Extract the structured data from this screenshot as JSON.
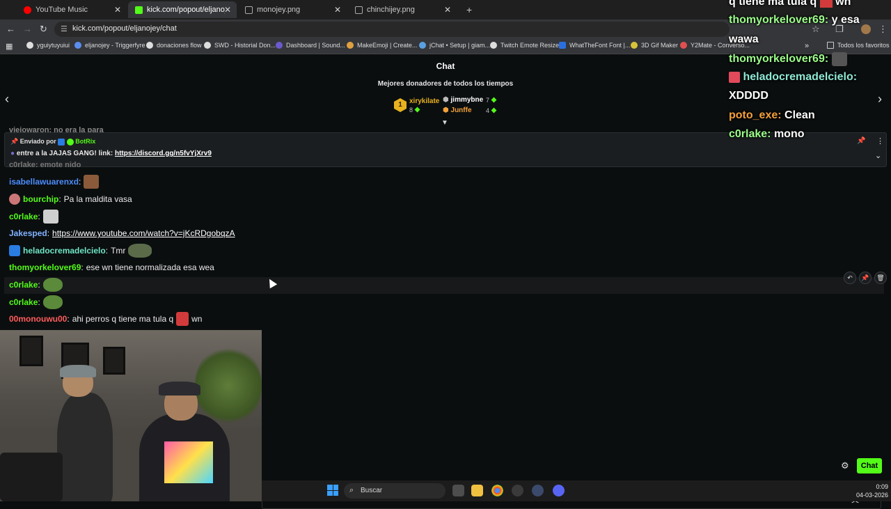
{
  "browser": {
    "tabs": [
      {
        "label": "YouTube Music",
        "active": false,
        "color": "#ff0000"
      },
      {
        "label": "kick.com/popout/eljanojey/cha",
        "active": true,
        "color": "#53fc18"
      },
      {
        "label": "monojey.png",
        "active": false,
        "color": "#888888"
      },
      {
        "label": "chinchijey.png",
        "active": false,
        "color": "#888888"
      }
    ],
    "url": "kick.com/popout/eljanojey/chat",
    "bookmarks": [
      "yguiytuyuiui",
      "eljanojey - Triggerfyre",
      "donaciones flow",
      "SWD - Historial Don...",
      "Dashboard | Sound...",
      "MakeEmoji | Create...",
      "jChat • Setup | giam...",
      "Twitch Emote Resizer",
      "WhatTheFont Font |...",
      "3D Gif Maker",
      "Y2Mate - Converso...",
      "Todos los favoritos"
    ]
  },
  "chat": {
    "title": "Chat",
    "top_donors_title": "Mejores donadores de todos los tiempos",
    "donors": [
      {
        "rank": "1",
        "name": "xirykilate",
        "count": "8",
        "color": "#e8b21f"
      },
      {
        "name": "jimmybne",
        "count": "7",
        "color": "#ffffff"
      },
      {
        "name": "Junffe",
        "count": "4",
        "color": "#f4a13a"
      }
    ],
    "peek_top": "viejowaron: no era la para",
    "peek_mid": "c0rlake: emote nido",
    "pinned": {
      "sent_by": "Enviado por",
      "bot_name": "BotRix",
      "message": "entre a la JAJAS GANG! link:",
      "link": "https://discord.gg/n5fvYjXrv9"
    },
    "messages": [
      {
        "user": "isabellawuarenxd",
        "color": "#4c8dff",
        "text": "",
        "emote": "#8a5a3a"
      },
      {
        "user": "bourchip",
        "color": "#53fc18",
        "text": "Pa la maldita vasa",
        "badge": "#c77"
      },
      {
        "user": "c0rlake",
        "color": "#53fc18",
        "text": "",
        "emote": "#cfcfcf"
      },
      {
        "user": "Jakesped",
        "color": "#7fb2ff",
        "text": "",
        "link": "https://www.youtube.com/watch?v=jKcRDgobqzA"
      },
      {
        "user": "heladocremadelcielo",
        "color": "#6fe7c7",
        "text": "Tmr",
        "badge": "#2a7de1",
        "emote": "#5b6b4a"
      },
      {
        "user": "thomyorkelover69",
        "color": "#53fc18",
        "text": "ese wn tiene normalizada esa wea"
      },
      {
        "user": "c0rlake",
        "color": "#53fc18",
        "text": "",
        "emote": "#5a8a3a"
      },
      {
        "user": "c0rlake",
        "color": "#53fc18",
        "text": "",
        "emote": "#5a8a3a"
      },
      {
        "user": "00monouwu00",
        "color": "#ff5c5c",
        "text": "ahi perros q tiene ma tula q",
        "emote": "#d23b3b",
        "text2": "wn"
      }
    ],
    "send_label": "Chat"
  },
  "overlay": [
    {
      "user": "",
      "text": "q tiene ma tula q",
      "text2": "wn",
      "color": "#ffffff"
    },
    {
      "user": "thomyorkelover69",
      "text": "y esa",
      "color": "#9cff8a"
    },
    {
      "user": "",
      "text": "wawa",
      "color": "#ffffff"
    },
    {
      "user": "thomyorkelover69",
      "text": "",
      "color": "#9cff8a"
    },
    {
      "user": "heladocremadelcielo",
      "text": "",
      "color": "#8fe9d5"
    },
    {
      "user": "",
      "text": "XDDDD",
      "color": "#ffffff"
    },
    {
      "user": "poto_exe",
      "text": "Clean",
      "color": "#f4a13a"
    },
    {
      "user": "c0rlake",
      "text": "mono",
      "color": "#9cff8a"
    }
  ],
  "taskbar": {
    "search_placeholder": "Buscar",
    "time": "0:09",
    "date": "04-03-2026"
  },
  "colors": {
    "kick_green": "#53fc18",
    "background": "#0b0e0f"
  }
}
